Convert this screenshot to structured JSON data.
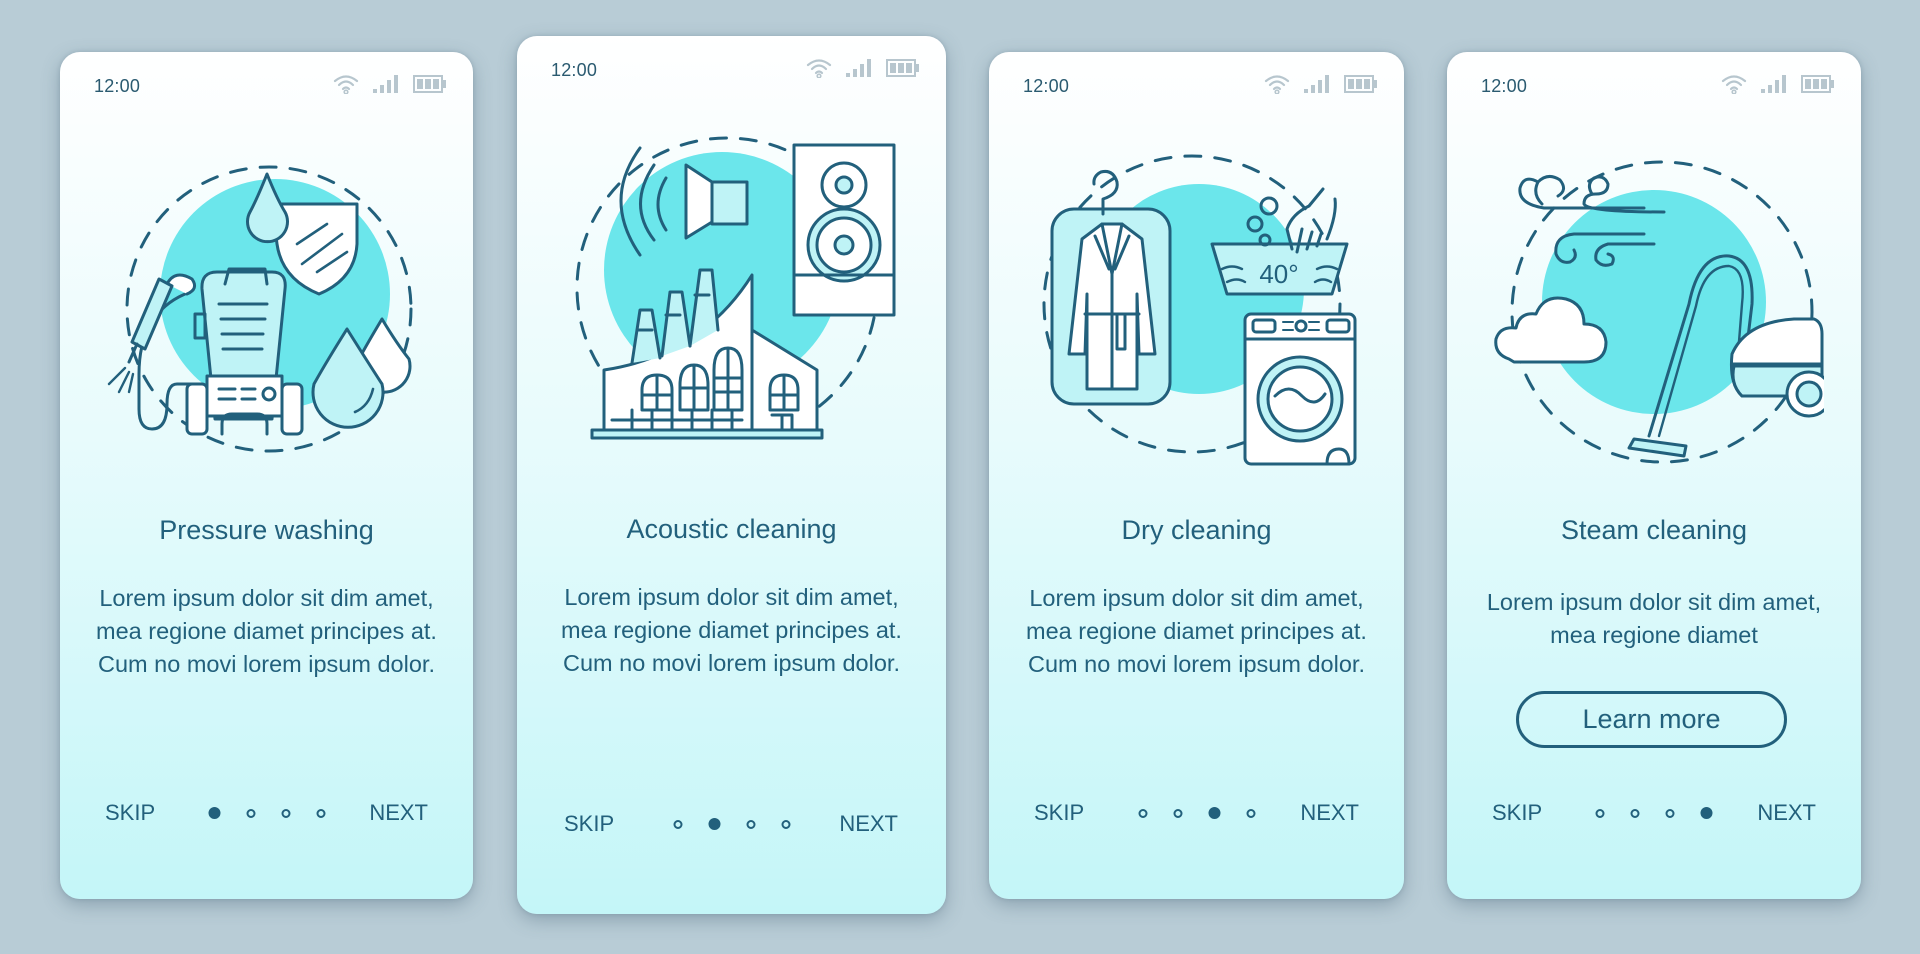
{
  "colors": {
    "background": "#b8ccd6",
    "accent": "#22607c",
    "highlight_circle": "#6be6eb",
    "card_top": "#ffffff",
    "card_bottom": "#c4f6f8",
    "status_icons": "#b7c6ce"
  },
  "status_bar": {
    "time": "12:00",
    "icons": [
      "wifi-icon",
      "signal-icon",
      "battery-icon"
    ]
  },
  "cards": [
    {
      "title": "Pressure washing",
      "body": "Lorem ipsum dolor sit dim amet, mea regione diamet principes at. Cum no movi lorem ipsum dolor.",
      "illustration": "pressure-washer-illustration",
      "active_page": 1,
      "skip_label": "SKIP",
      "next_label": "NEXT"
    },
    {
      "title": "Acoustic cleaning",
      "body": "Lorem ipsum dolor sit dim amet, mea regione diamet principes at. Cum no movi lorem ipsum dolor.",
      "illustration": "factory-speaker-illustration",
      "active_page": 2,
      "skip_label": "SKIP",
      "next_label": "NEXT"
    },
    {
      "title": "Dry cleaning",
      "body": "Lorem ipsum dolor sit dim amet, mea regione diamet principes at. Cum no movi lorem ipsum dolor.",
      "illustration": "coat-washing-machine-illustration",
      "temperature_label": "40°",
      "active_page": 3,
      "skip_label": "SKIP",
      "next_label": "NEXT"
    },
    {
      "title": "Steam cleaning",
      "body": "Lorem ipsum dolor sit dim amet, mea regione diamet",
      "illustration": "vacuum-steam-illustration",
      "button_label": "Learn more",
      "active_page": 4,
      "skip_label": "SKIP",
      "next_label": "NEXT"
    }
  ],
  "pagination": {
    "total_pages": 4
  }
}
